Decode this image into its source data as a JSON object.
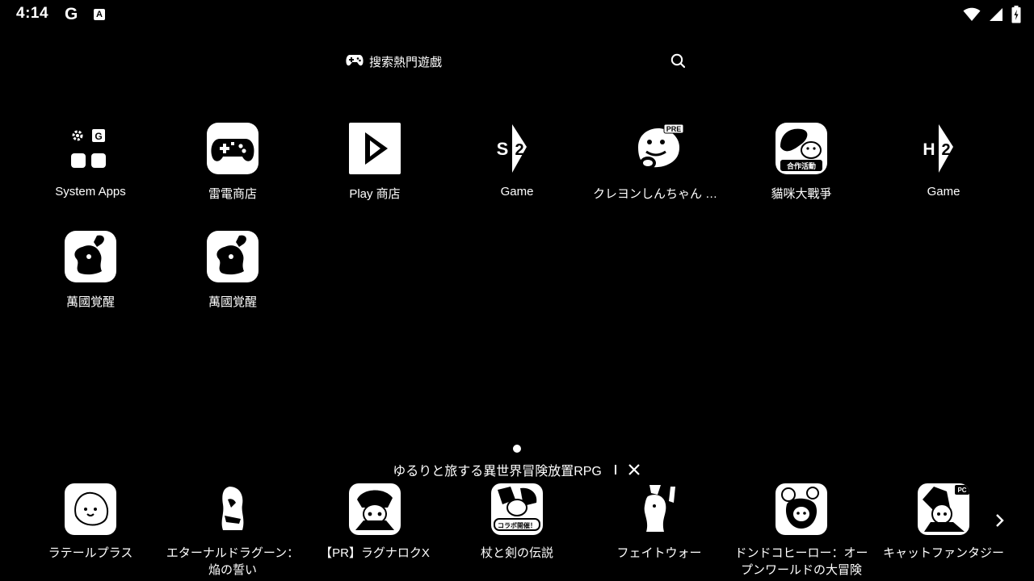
{
  "status_bar": {
    "time": "4:14",
    "google_glyph": "G",
    "badge_glyph": "A",
    "icons": [
      "wifi-icon",
      "signal-icon",
      "battery-icon"
    ]
  },
  "search": {
    "placeholder": "搜索熱門遊戲",
    "left_icon": "gamepad-icon",
    "right_icon": "search-icon"
  },
  "apps": [
    {
      "label": "System Apps",
      "icon": "system-apps-folder-icon"
    },
    {
      "label": "雷電商店",
      "icon": "ldstore-gamepad-icon"
    },
    {
      "label": "Play 商店",
      "icon": "play-store-icon"
    },
    {
      "label": "Game",
      "icon": "game-s2-icon",
      "glyph": "S2"
    },
    {
      "label": "クレヨンしんちゃん オ…",
      "icon": "crayon-shinchan-icon",
      "badge": "PRE"
    },
    {
      "label": "貓咪大戰爭",
      "icon": "battle-cats-icon",
      "badge": "合作活動"
    },
    {
      "label": "Game",
      "icon": "game-h2-icon",
      "glyph": "H2"
    },
    {
      "label": "萬國覚醒",
      "icon": "rise-of-kingdoms-icon"
    },
    {
      "label": "萬國覚醒",
      "icon": "rise-of-kingdoms-icon"
    }
  ],
  "ad": {
    "text": "ゆるりと旅する異世界冒険放置RPG",
    "close_icon": "close-icon"
  },
  "recommended": [
    {
      "label": "ラテールプラス",
      "icon": "latale-plus-icon"
    },
    {
      "label": "エターナルドラグーン：焔の誓い",
      "icon": "eternal-dragoon-icon"
    },
    {
      "label": "【PR】ラグナロクX",
      "icon": "ragnarok-x-icon"
    },
    {
      "label": "杖と剣の伝説",
      "icon": "tsue-to-ken-icon",
      "badge": "コラボ開催！"
    },
    {
      "label": "フェイトウォー",
      "icon": "fate-war-icon"
    },
    {
      "label": "ドンドコヒーロー：オープンワールドの大冒険",
      "icon": "dondoko-hero-icon"
    },
    {
      "label": "キャットファンタジー",
      "icon": "cat-fantasy-icon",
      "badge": "PC"
    }
  ],
  "next_icon": "chevron-right-icon"
}
